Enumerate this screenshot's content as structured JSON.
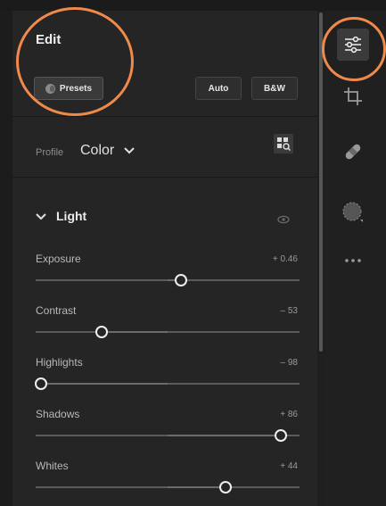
{
  "panel": {
    "title": "Edit",
    "buttons": {
      "presets": "Presets",
      "auto": "Auto",
      "bw": "B&W"
    },
    "profile": {
      "label": "Profile",
      "value": "Color"
    },
    "section": {
      "title": "Light"
    },
    "sliders": [
      {
        "label": "Exposure",
        "value": "+ 0.46",
        "position": 0.55
      },
      {
        "label": "Contrast",
        "value": "– 53",
        "position": 0.25
      },
      {
        "label": "Highlights",
        "value": "– 98",
        "position": 0.02
      },
      {
        "label": "Shadows",
        "value": "+ 86",
        "position": 0.93
      },
      {
        "label": "Whites",
        "value": "+ 44",
        "position": 0.72
      }
    ]
  },
  "rail": {
    "tools": [
      {
        "icon": "sliders-icon",
        "active": true
      },
      {
        "icon": "crop-icon",
        "active": false
      },
      {
        "icon": "bandage-icon",
        "active": false
      },
      {
        "icon": "mask-icon",
        "active": false
      },
      {
        "icon": "more-icon",
        "active": false
      }
    ]
  },
  "colors": {
    "highlight": "#f08a4b",
    "background": "#252525",
    "thumb": "#efefef"
  }
}
